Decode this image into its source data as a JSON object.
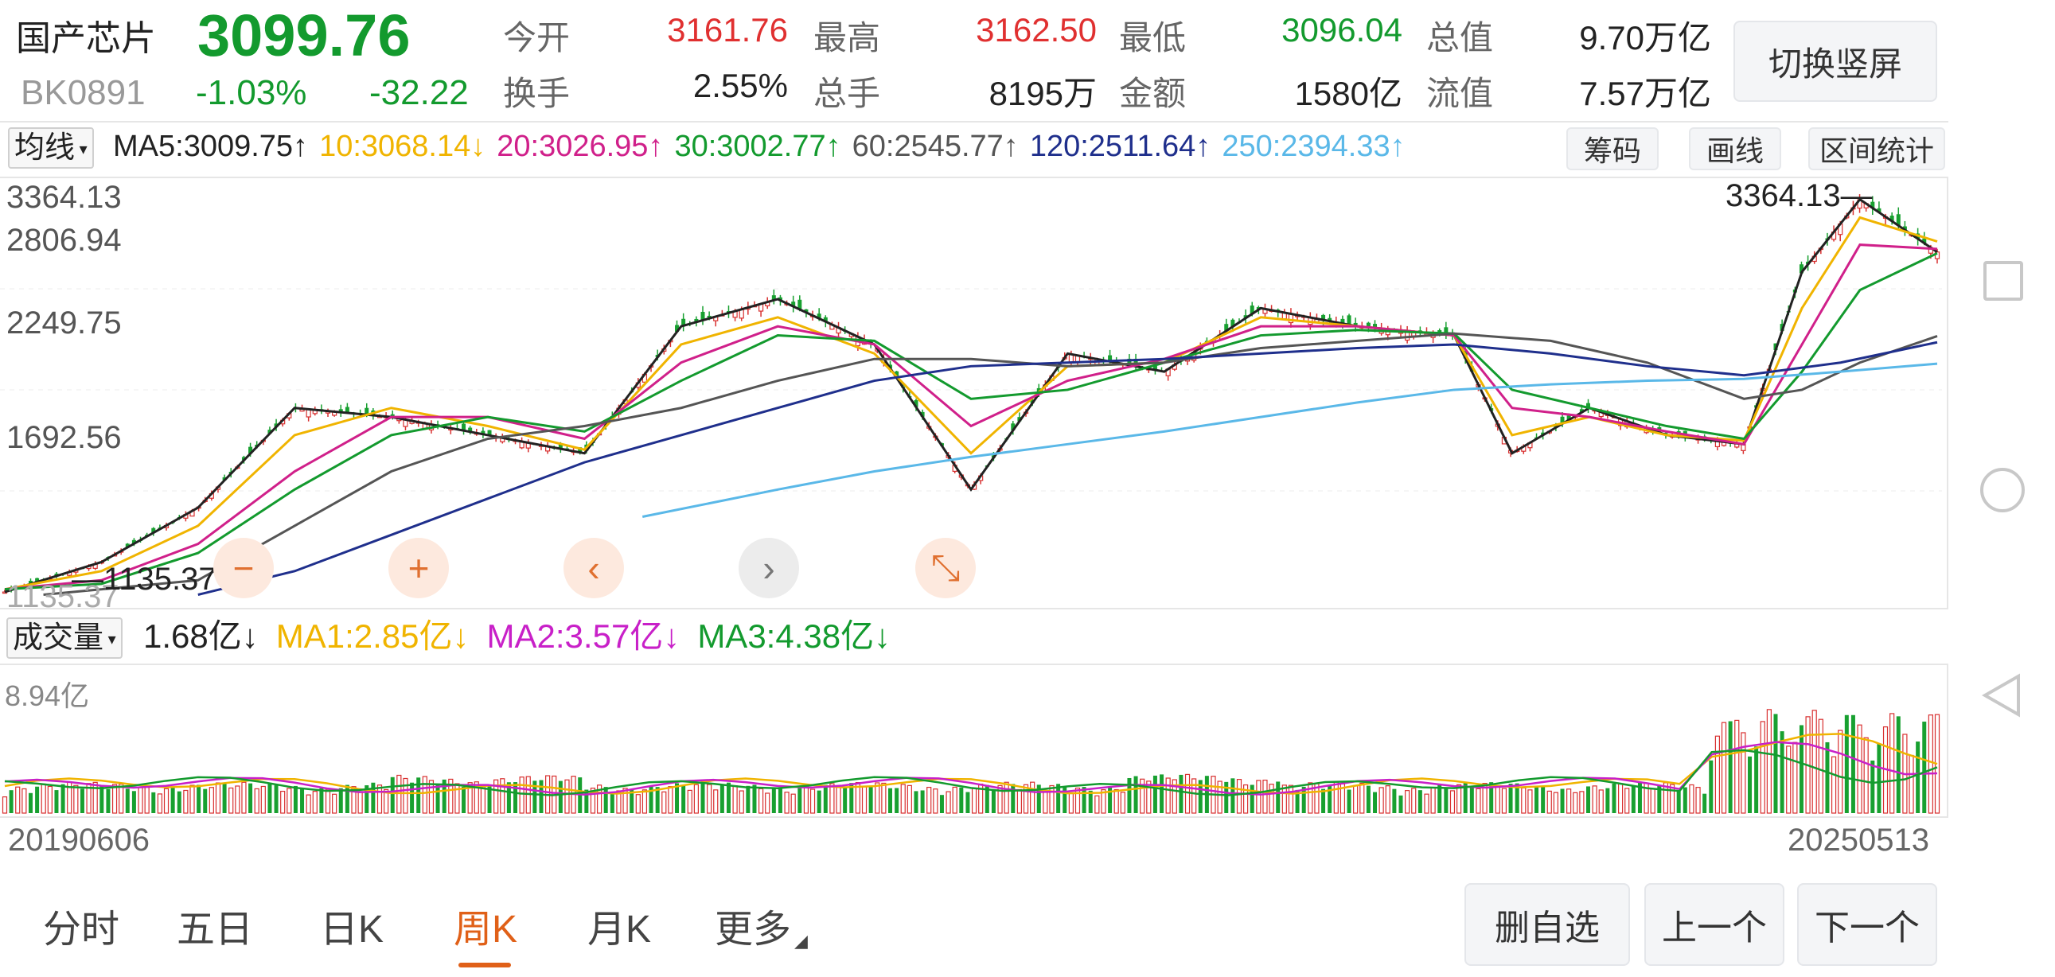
{
  "stock": {
    "name": "国产芯片",
    "code": "BK0891",
    "price": "3099.76",
    "change_pct": "-1.03%",
    "change_abs": "-32.22"
  },
  "quote": [
    {
      "label": "今开",
      "value": "3161.76",
      "color": "red"
    },
    {
      "label": "最高",
      "value": "3162.50",
      "color": "red"
    },
    {
      "label": "最低",
      "value": "3096.04",
      "color": "green"
    },
    {
      "label": "总值",
      "value": "9.70万亿",
      "color": "dark"
    },
    {
      "label": "换手",
      "value": "2.55%",
      "color": "dark"
    },
    {
      "label": "总手",
      "value": "8195万",
      "color": "dark"
    },
    {
      "label": "金额",
      "value": "1580亿",
      "color": "dark"
    },
    {
      "label": "流值",
      "value": "7.57万亿",
      "color": "dark"
    }
  ],
  "switch_button": "切换竖屏",
  "ma_selector": "均线",
  "ma_values": [
    {
      "text": "MA5:3009.75↑",
      "color": "#222222"
    },
    {
      "text": "10:3068.14↓",
      "color": "#f0b400"
    },
    {
      "text": "20:3026.95↑",
      "color": "#d0208a"
    },
    {
      "text": "30:3002.77↑",
      "color": "#139a2e"
    },
    {
      "text": "60:2545.77↑",
      "color": "#555555"
    },
    {
      "text": "120:2511.64↑",
      "color": "#1f2f8c"
    },
    {
      "text": "250:2394.33↑",
      "color": "#5ab8e8"
    }
  ],
  "tools": [
    "筹码",
    "画线",
    "区间统计"
  ],
  "price_axis": [
    "3364.13",
    "2806.94",
    "2249.75",
    "1692.56"
  ],
  "price_high_marker": "3364.13",
  "price_low_marker": "1135.37",
  "price_low_axis": "1135.37",
  "volume_selector": "成交量",
  "volume_values": [
    {
      "text": "1.68亿↓",
      "color": "#222222"
    },
    {
      "text": "MA1:2.85亿↓",
      "color": "#f0b400"
    },
    {
      "text": "MA2:3.57亿↓",
      "color": "#c820c8"
    },
    {
      "text": "MA3:4.38亿↓",
      "color": "#139a2e"
    }
  ],
  "volume_axis_top": "8.94亿",
  "date_start": "20190606",
  "date_end": "20250513",
  "zoom_controls": {
    "minus": "−",
    "plus": "+",
    "left": "‹",
    "right": "›",
    "shrink": "⤡"
  },
  "tabs": [
    {
      "label": "分时"
    },
    {
      "label": "五日"
    },
    {
      "label": "日K"
    },
    {
      "label": "周K",
      "active": true
    },
    {
      "label": "月K"
    },
    {
      "label": "更多"
    }
  ],
  "bottom_buttons": [
    "删自选",
    "上一个",
    "下一个"
  ],
  "chart_data": {
    "type": "line",
    "series": [
      {
        "name": "MA5",
        "color": "#222222",
        "points": [
          [
            0,
            1135
          ],
          [
            0.05,
            1300
          ],
          [
            0.1,
            1600
          ],
          [
            0.15,
            2150
          ],
          [
            0.2,
            2100
          ],
          [
            0.25,
            2000
          ],
          [
            0.3,
            1900
          ],
          [
            0.35,
            2600
          ],
          [
            0.4,
            2750
          ],
          [
            0.45,
            2500
          ],
          [
            0.5,
            1700
          ],
          [
            0.55,
            2450
          ],
          [
            0.6,
            2350
          ],
          [
            0.65,
            2700
          ],
          [
            0.7,
            2600
          ],
          [
            0.75,
            2550
          ],
          [
            0.78,
            1900
          ],
          [
            0.82,
            2150
          ],
          [
            0.86,
            2000
          ],
          [
            0.9,
            1950
          ],
          [
            0.93,
            2900
          ],
          [
            0.96,
            3300
          ],
          [
            1.0,
            3010
          ]
        ]
      },
      {
        "name": "MA10",
        "color": "#f0b400",
        "points": [
          [
            0,
            1150
          ],
          [
            0.05,
            1250
          ],
          [
            0.1,
            1500
          ],
          [
            0.15,
            2000
          ],
          [
            0.2,
            2150
          ],
          [
            0.25,
            2050
          ],
          [
            0.3,
            1920
          ],
          [
            0.35,
            2500
          ],
          [
            0.4,
            2650
          ],
          [
            0.45,
            2450
          ],
          [
            0.5,
            1900
          ],
          [
            0.55,
            2380
          ],
          [
            0.6,
            2400
          ],
          [
            0.65,
            2650
          ],
          [
            0.7,
            2600
          ],
          [
            0.75,
            2550
          ],
          [
            0.78,
            2000
          ],
          [
            0.82,
            2100
          ],
          [
            0.86,
            2000
          ],
          [
            0.9,
            1970
          ],
          [
            0.93,
            2700
          ],
          [
            0.96,
            3200
          ],
          [
            1.0,
            3068
          ]
        ]
      },
      {
        "name": "MA20",
        "color": "#d0208a",
        "points": [
          [
            0,
            1150
          ],
          [
            0.05,
            1200
          ],
          [
            0.1,
            1400
          ],
          [
            0.15,
            1800
          ],
          [
            0.2,
            2100
          ],
          [
            0.25,
            2100
          ],
          [
            0.3,
            1980
          ],
          [
            0.35,
            2400
          ],
          [
            0.4,
            2600
          ],
          [
            0.45,
            2500
          ],
          [
            0.5,
            2050
          ],
          [
            0.55,
            2300
          ],
          [
            0.6,
            2420
          ],
          [
            0.65,
            2600
          ],
          [
            0.7,
            2600
          ],
          [
            0.75,
            2550
          ],
          [
            0.78,
            2150
          ],
          [
            0.82,
            2100
          ],
          [
            0.86,
            2020
          ],
          [
            0.9,
            1950
          ],
          [
            0.93,
            2500
          ],
          [
            0.96,
            3050
          ],
          [
            1.0,
            3027
          ]
        ]
      },
      {
        "name": "MA30",
        "color": "#139a2e",
        "points": [
          [
            0,
            1150
          ],
          [
            0.05,
            1180
          ],
          [
            0.1,
            1350
          ],
          [
            0.15,
            1700
          ],
          [
            0.2,
            2000
          ],
          [
            0.25,
            2100
          ],
          [
            0.3,
            2020
          ],
          [
            0.35,
            2300
          ],
          [
            0.4,
            2550
          ],
          [
            0.45,
            2520
          ],
          [
            0.5,
            2200
          ],
          [
            0.55,
            2250
          ],
          [
            0.6,
            2400
          ],
          [
            0.65,
            2550
          ],
          [
            0.7,
            2580
          ],
          [
            0.75,
            2560
          ],
          [
            0.78,
            2250
          ],
          [
            0.82,
            2150
          ],
          [
            0.86,
            2050
          ],
          [
            0.9,
            1980
          ],
          [
            0.93,
            2350
          ],
          [
            0.96,
            2800
          ],
          [
            1.0,
            3003
          ]
        ]
      },
      {
        "name": "MA60",
        "color": "#555555",
        "points": [
          [
            0.02,
            1120
          ],
          [
            0.1,
            1200
          ],
          [
            0.15,
            1500
          ],
          [
            0.2,
            1800
          ],
          [
            0.25,
            1980
          ],
          [
            0.3,
            2050
          ],
          [
            0.35,
            2150
          ],
          [
            0.4,
            2300
          ],
          [
            0.45,
            2420
          ],
          [
            0.5,
            2420
          ],
          [
            0.55,
            2380
          ],
          [
            0.6,
            2400
          ],
          [
            0.65,
            2480
          ],
          [
            0.7,
            2520
          ],
          [
            0.75,
            2560
          ],
          [
            0.8,
            2520
          ],
          [
            0.85,
            2400
          ],
          [
            0.9,
            2200
          ],
          [
            0.93,
            2250
          ],
          [
            0.96,
            2400
          ],
          [
            1.0,
            2546
          ]
        ]
      },
      {
        "name": "MA120",
        "color": "#1f2f8c",
        "points": [
          [
            0.1,
            1120
          ],
          [
            0.15,
            1250
          ],
          [
            0.2,
            1450
          ],
          [
            0.25,
            1650
          ],
          [
            0.3,
            1850
          ],
          [
            0.35,
            2000
          ],
          [
            0.4,
            2150
          ],
          [
            0.45,
            2300
          ],
          [
            0.5,
            2380
          ],
          [
            0.55,
            2400
          ],
          [
            0.6,
            2420
          ],
          [
            0.65,
            2450
          ],
          [
            0.7,
            2480
          ],
          [
            0.75,
            2500
          ],
          [
            0.8,
            2450
          ],
          [
            0.85,
            2380
          ],
          [
            0.9,
            2330
          ],
          [
            0.95,
            2400
          ],
          [
            1.0,
            2512
          ]
        ]
      },
      {
        "name": "MA250",
        "color": "#5ab8e8",
        "points": [
          [
            0.33,
            1550
          ],
          [
            0.4,
            1700
          ],
          [
            0.45,
            1800
          ],
          [
            0.5,
            1880
          ],
          [
            0.55,
            1950
          ],
          [
            0.6,
            2020
          ],
          [
            0.65,
            2100
          ],
          [
            0.7,
            2180
          ],
          [
            0.75,
            2250
          ],
          [
            0.8,
            2280
          ],
          [
            0.85,
            2300
          ],
          [
            0.9,
            2310
          ],
          [
            0.95,
            2350
          ],
          [
            1.0,
            2394
          ]
        ]
      }
    ],
    "ylim": [
      1135.37,
      3364.13
    ]
  }
}
